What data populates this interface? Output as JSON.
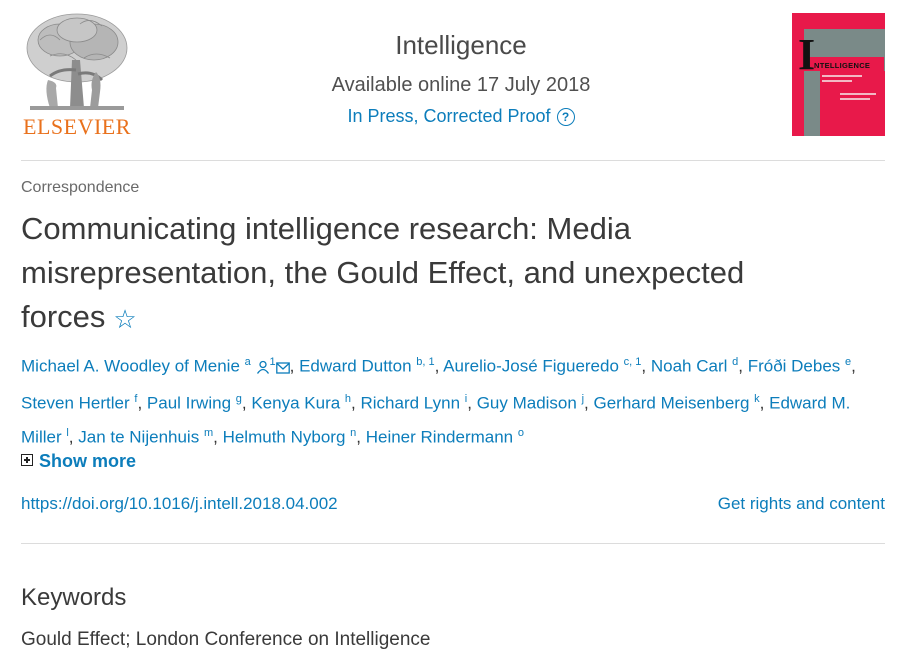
{
  "publisher": {
    "logo_text": "ELSEVIER"
  },
  "journal": {
    "title": "Intelligence",
    "available": "Available online 17 July 2018",
    "status": "In Press, Corrected Proof",
    "help_icon": "?"
  },
  "cover": {
    "title": "NTELLIGENCE",
    "initial": "I"
  },
  "article": {
    "type": "Correspondence",
    "title": "Communicating intelligence research: Media misrepresentation, the Gould Effect, and unexpected forces",
    "bookmark_icon": "star-outline-icon"
  },
  "authors": [
    {
      "name": "Michael A. Woodley of Menie",
      "sup": "a"
    },
    {
      "name": "Edward Dutton",
      "sup": "b, 1"
    },
    {
      "name": "Aurelio-José Figueredo",
      "sup": "c, 1"
    },
    {
      "name": "Noah Carl",
      "sup": "d"
    },
    {
      "name": "Fróði Debes",
      "sup": "e"
    },
    {
      "name": "Steven Hertler",
      "sup": "f"
    },
    {
      "name": "Paul Irwing",
      "sup": "g"
    },
    {
      "name": "Kenya Kura",
      "sup": "h"
    },
    {
      "name": "Richard Lynn",
      "sup": "i"
    },
    {
      "name": "Guy Madison",
      "sup": "j"
    },
    {
      "name": "Gerhard Meisenberg",
      "sup": "k"
    },
    {
      "name": "Edward M. Miller",
      "sup": "l"
    },
    {
      "name": "Jan te Nijenhuis",
      "sup": "m"
    },
    {
      "name": "Helmuth Nyborg",
      "sup": "n"
    },
    {
      "name": "Heiner Rindermann",
      "sup": "o"
    }
  ],
  "first_author_extra_sup": "1",
  "show_more": "Show more",
  "doi": "https://doi.org/10.1016/j.intell.2018.04.002",
  "rights": "Get rights and content",
  "keywords": {
    "heading": "Keywords",
    "list": "Gould Effect; London Conference on Intelligence"
  },
  "colors": {
    "link": "#0c7dbb",
    "brand_orange": "#e9711c",
    "cover_red": "#e8194a",
    "cover_gray": "#7a8a88"
  }
}
